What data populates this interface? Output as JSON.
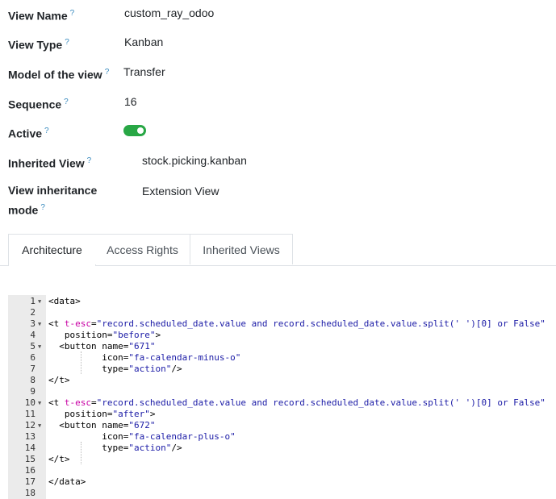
{
  "fields": [
    {
      "label": "View Name",
      "value": "custom_ray_odoo"
    },
    {
      "label": "View Type",
      "value": "Kanban"
    },
    {
      "label": "Model of the view",
      "value": "Transfer"
    },
    {
      "label": "Sequence",
      "value": "16"
    },
    {
      "label": "Active",
      "value": ""
    },
    {
      "label": "Inherited View",
      "value": "stock.picking.kanban"
    },
    {
      "label": "View inheritance",
      "label2": "mode",
      "value": "Extension View"
    }
  ],
  "help_mark": "?",
  "active_toggle": {
    "on": true,
    "color": "#28a745"
  },
  "tabs": [
    {
      "label": "Architecture",
      "active": true
    },
    {
      "label": "Access Rights",
      "active": false
    },
    {
      "label": "Inherited Views",
      "active": false
    }
  ],
  "code_lines": [
    {
      "n": "1",
      "fold": true,
      "text": "<data>"
    },
    {
      "n": "2",
      "fold": false,
      "text": ""
    },
    {
      "n": "3",
      "fold": true,
      "parts": [
        [
          "",
          "<t "
        ],
        [
          "attr",
          "t-esc"
        ],
        [
          "",
          "="
        ],
        [
          "str",
          "\"record.scheduled_date.value and record.scheduled_date.value.split(' ')[0] or False\""
        ]
      ]
    },
    {
      "n": "4",
      "fold": false,
      "parts": [
        [
          "",
          "   position="
        ],
        [
          "str",
          "\"before\""
        ],
        [
          "",
          ">"
        ]
      ]
    },
    {
      "n": "5",
      "fold": true,
      "parts": [
        [
          "",
          "  <button name="
        ],
        [
          "str",
          "\"671\""
        ]
      ]
    },
    {
      "n": "6",
      "fold": false,
      "parts": [
        [
          "",
          "          icon="
        ],
        [
          "str",
          "\"fa-calendar-minus-o\""
        ]
      ]
    },
    {
      "n": "7",
      "fold": false,
      "parts": [
        [
          "",
          "          type="
        ],
        [
          "str",
          "\"action\""
        ],
        [
          "",
          "/>"
        ]
      ]
    },
    {
      "n": "8",
      "fold": false,
      "text": "</t>"
    },
    {
      "n": "9",
      "fold": false,
      "text": ""
    },
    {
      "n": "10",
      "fold": true,
      "parts": [
        [
          "",
          "<t "
        ],
        [
          "attr",
          "t-esc"
        ],
        [
          "",
          "="
        ],
        [
          "str",
          "\"record.scheduled_date.value and record.scheduled_date.value.split(' ')[0] or False\""
        ]
      ]
    },
    {
      "n": "11",
      "fold": false,
      "parts": [
        [
          "",
          "   position="
        ],
        [
          "str",
          "\"after\""
        ],
        [
          "",
          ">"
        ]
      ]
    },
    {
      "n": "12",
      "fold": true,
      "parts": [
        [
          "",
          "  <button name="
        ],
        [
          "str",
          "\"672\""
        ]
      ]
    },
    {
      "n": "13",
      "fold": false,
      "parts": [
        [
          "",
          "          icon="
        ],
        [
          "str",
          "\"fa-calendar-plus-o\""
        ]
      ]
    },
    {
      "n": "14",
      "fold": false,
      "parts": [
        [
          "",
          "          type="
        ],
        [
          "str",
          "\"action\""
        ],
        [
          "",
          "/>"
        ]
      ]
    },
    {
      "n": "15",
      "fold": false,
      "text": "</t>"
    },
    {
      "n": "16",
      "fold": false,
      "text": ""
    },
    {
      "n": "17",
      "fold": false,
      "text": "</data>"
    },
    {
      "n": "18",
      "fold": false,
      "text": ""
    }
  ]
}
